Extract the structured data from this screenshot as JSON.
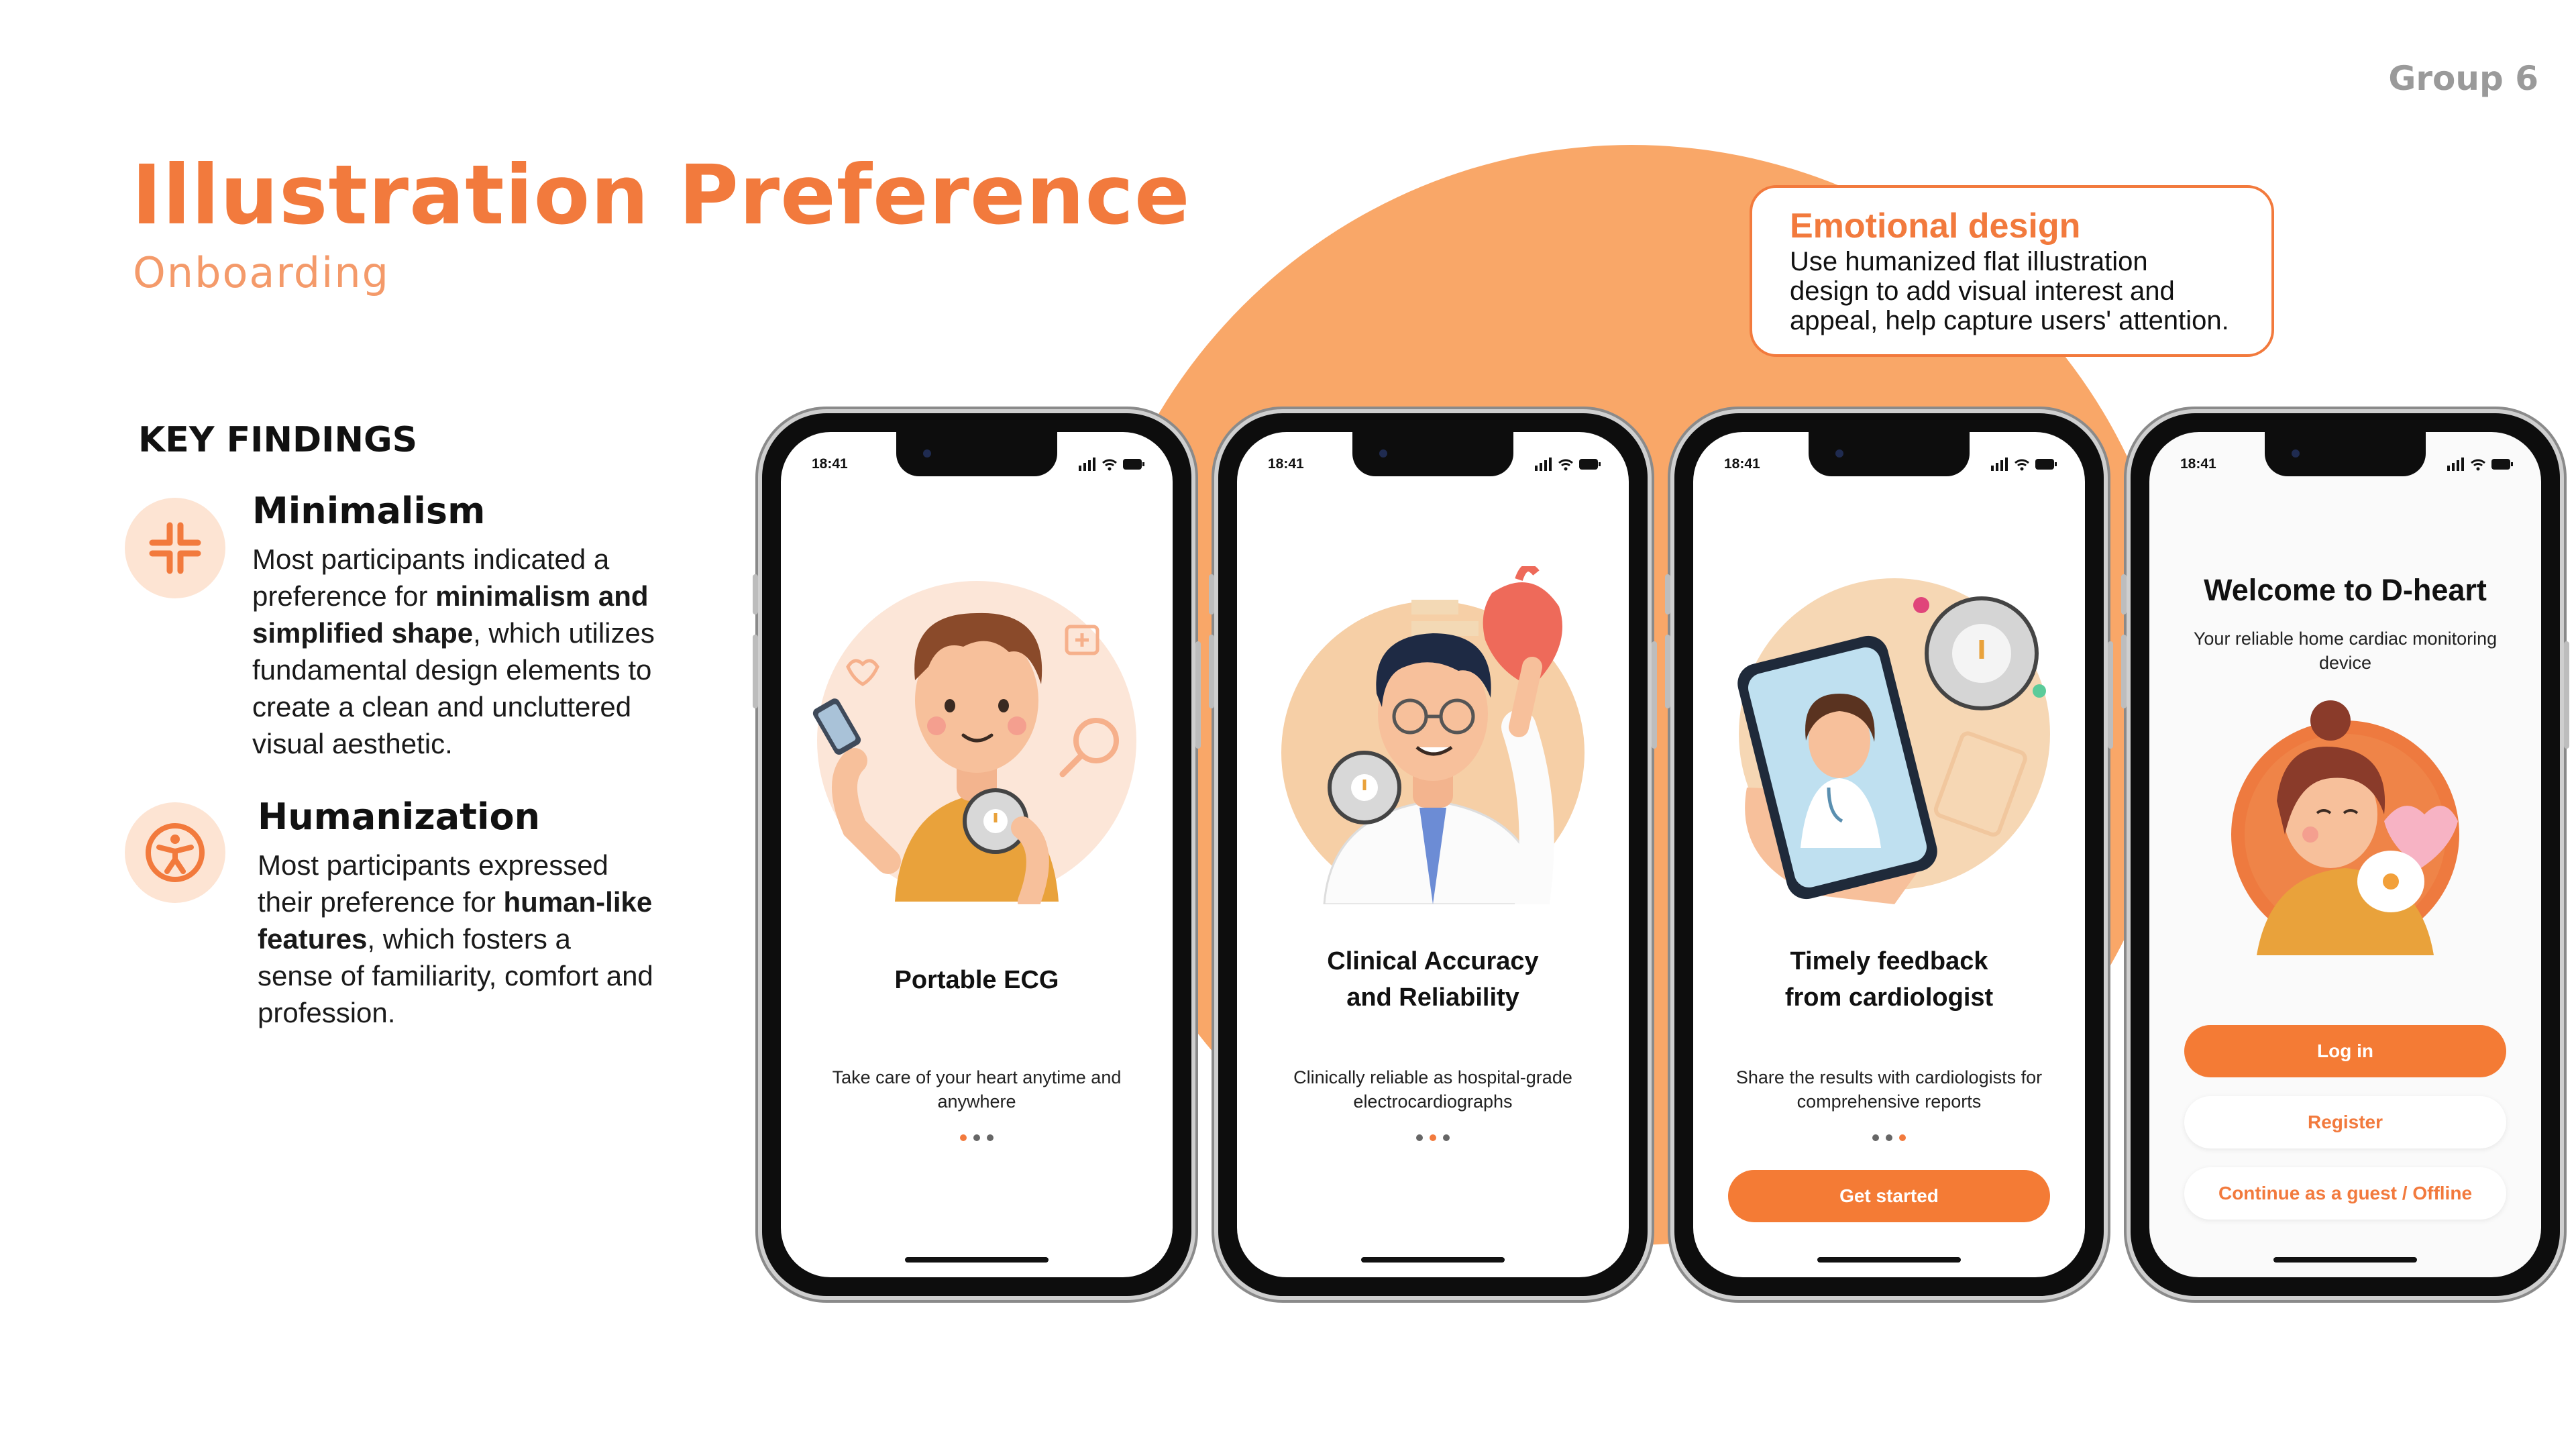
{
  "slide": {
    "group_label": "Group 6",
    "title": "Illustration Preference",
    "subtitle": "Onboarding",
    "key_findings_heading": "KEY FINDINGS"
  },
  "findings": [
    {
      "title": "Minimalism",
      "icon": "compress-arrows-icon",
      "text_before": "Most participants indicated a preference for ",
      "text_bold": "minimalism and simplified shape",
      "text_after": ", which utilizes fundamental design elements to create a clean and uncluttered visual aesthetic."
    },
    {
      "title": "Humanization",
      "icon": "accessibility-person-icon",
      "text_before": "Most participants expressed their preference for ",
      "text_bold": "human-like features",
      "text_after": ", which fosters a sense of familiarity, comfort and profession."
    }
  ],
  "callout": {
    "title": "Emotional design",
    "body": "Use humanized flat illustration design to add visual interest and appeal, help capture users' attention."
  },
  "phones": [
    {
      "time": "18:41",
      "title_line1": "Portable ECG",
      "title_line2": "",
      "desc": "Take care of your heart anytime and anywhere",
      "active_dot": 0
    },
    {
      "time": "18:41",
      "title_line1": "Clinical Accuracy",
      "title_line2": "and Reliability",
      "desc": "Clinically reliable as hospital-grade electrocardiographs",
      "active_dot": 1
    },
    {
      "time": "18:41",
      "title_line1": "Timely feedback",
      "title_line2": "from cardiologist",
      "desc": "Share the results with cardiologists for comprehensive reports",
      "active_dot": 2,
      "button": "Get started"
    },
    {
      "time": "18:41",
      "welcome_title": "Welcome to D-heart",
      "welcome_sub": "Your reliable home cardiac monitoring device",
      "login": "Log in",
      "register": "Register",
      "guest": "Continue as a guest / Offline"
    }
  ],
  "colors": {
    "accent": "#F27A3D",
    "circle": "#F9A768",
    "icon_bg": "#FDE4D3"
  }
}
